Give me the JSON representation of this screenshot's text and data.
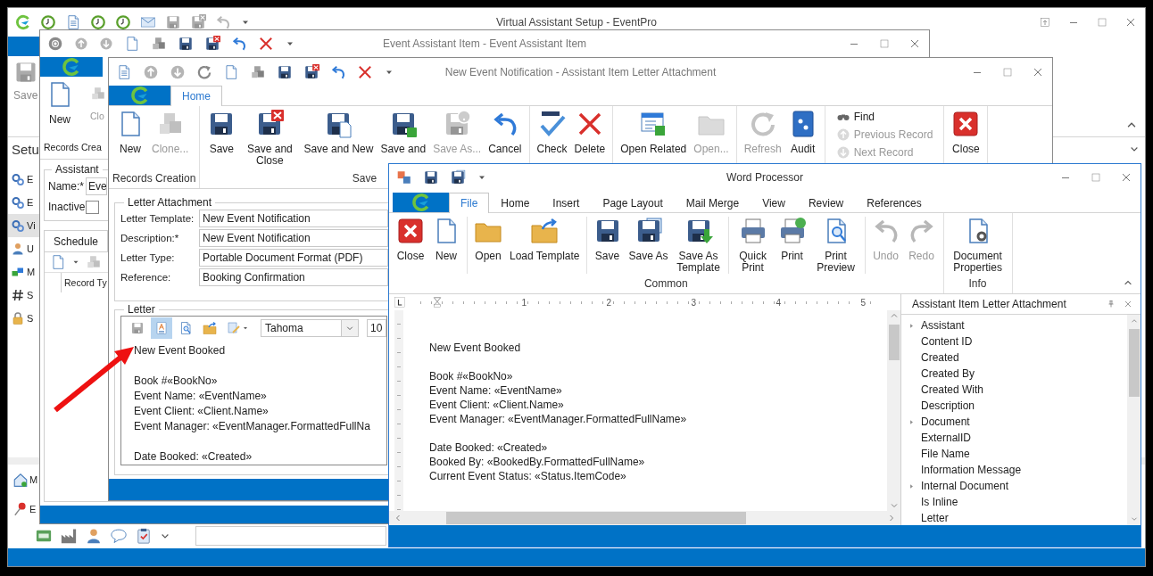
{
  "main_window": {
    "title": "Virtual Assistant Setup - EventPro",
    "ribbon_button": "Save",
    "section_title": "Setu",
    "sidebar_items": [
      {
        "label": "E",
        "selected": false
      },
      {
        "label": "E",
        "selected": false
      },
      {
        "label": "Vi",
        "selected": true
      },
      {
        "label": "U",
        "selected": false
      },
      {
        "label": "M",
        "selected": false
      },
      {
        "label": "S",
        "selected": false
      },
      {
        "label": "S",
        "selected": false
      }
    ],
    "nav_items": [
      "M",
      "E"
    ]
  },
  "assistant_window": {
    "title": "Event Assistant Item - Event Assistant Item",
    "ribbon_buttons": [
      "New",
      "Clo"
    ],
    "ribbon_group": "Records Crea",
    "group_title": "Assistant",
    "name_label": "Name:*",
    "name_value": "Eve",
    "inactive_label": "Inactive",
    "inactive_checked": false,
    "tabs": [
      {
        "label": "Schedule",
        "selected": true
      }
    ],
    "column": "Record Ty"
  },
  "letter_window": {
    "title": "New Event Notification - Assistant Item Letter Attachment",
    "tabs": [
      {
        "label": "Home",
        "selected": true
      }
    ],
    "ribbon_groups": [
      {
        "label": "Records Creation",
        "buttons": [
          {
            "label": "New",
            "disabled": false
          },
          {
            "label": "Clone...",
            "disabled": true
          }
        ]
      },
      {
        "label": "Save",
        "buttons": [
          {
            "label": "Save",
            "disabled": false
          },
          {
            "label": "Save and Close",
            "disabled": false
          },
          {
            "label": "Save and New",
            "disabled": false
          },
          {
            "label": "Save and",
            "disabled": false
          },
          {
            "label": "Save As...",
            "disabled": true
          },
          {
            "label": "Cancel",
            "disabled": false
          }
        ]
      },
      {
        "buttons": [
          {
            "label": "Check",
            "disabled": false
          },
          {
            "label": "Delete",
            "disabled": false
          }
        ]
      },
      {
        "buttons": [
          {
            "label": "Open Related",
            "disabled": false
          },
          {
            "label": "Open...",
            "disabled": true
          }
        ]
      },
      {
        "buttons": [
          {
            "label": "Refresh",
            "disabled": true
          },
          {
            "label": "Audit",
            "disabled": false
          }
        ]
      },
      {
        "small_buttons": [
          {
            "label": "Find",
            "disabled": false
          },
          {
            "label": "Previous Record",
            "disabled": true
          },
          {
            "label": "Next Record",
            "disabled": true
          }
        ]
      },
      {
        "buttons": [
          {
            "label": "Close",
            "disabled": false
          }
        ]
      }
    ],
    "letter_attachment": {
      "title": "Letter Attachment",
      "fields": [
        {
          "label": "Letter Template:",
          "value": "New Event Notification"
        },
        {
          "label": "Description:*",
          "value": "New Event Notification"
        },
        {
          "label": "Letter Type:",
          "value": "Portable Document Format (PDF)"
        },
        {
          "label": "Reference:",
          "value": "Booking Confirmation"
        }
      ]
    },
    "letter": {
      "title": "Letter",
      "toolbar": [
        {
          "selected": false
        },
        {
          "selected": true
        },
        {
          "selected": false
        },
        {
          "selected": false
        },
        {
          "selected": false
        }
      ],
      "font": "Tahoma",
      "font_size": "10",
      "blocks": [
        [
          "New Event Booked"
        ],
        [
          "Book #«BookNo»",
          "Event Name: «EventName»",
          "Event Client: «Client.Name»",
          "Event Manager: «EventManager.FormattedFullNa"
        ],
        [
          "Date Booked: «Created»"
        ]
      ]
    }
  },
  "word_window": {
    "title": "Word Processor",
    "tabs": [
      {
        "label": "File",
        "selected": true
      },
      {
        "label": "Home",
        "selected": false
      },
      {
        "label": "Insert",
        "selected": false
      },
      {
        "label": "Page Layout",
        "selected": false
      },
      {
        "label": "Mail Merge",
        "selected": false
      },
      {
        "label": "View",
        "selected": false
      },
      {
        "label": "Review",
        "selected": false
      },
      {
        "label": "References",
        "selected": false
      }
    ],
    "ribbon_groups": [
      {
        "label": "Common",
        "buttons": [
          {
            "label": "Close",
            "disabled": false
          },
          {
            "label": "New",
            "disabled": false
          },
          {
            "label": "Open",
            "disabled": false
          },
          {
            "label": "Load Template",
            "disabled": false
          },
          {
            "label": "Save",
            "disabled": false
          },
          {
            "label": "Save As",
            "disabled": false
          },
          {
            "label": "Save As Template",
            "disabled": false
          },
          {
            "label": "Quick Print",
            "disabled": false
          },
          {
            "label": "Print",
            "disabled": false
          },
          {
            "label": "Print Preview",
            "disabled": false
          },
          {
            "label": "Undo",
            "disabled": true
          },
          {
            "label": "Redo",
            "disabled": true
          }
        ]
      },
      {
        "label": "Info",
        "buttons": [
          {
            "label": "Document Properties",
            "disabled": false
          }
        ]
      }
    ],
    "ruler_marks": [
      "1",
      "2",
      "3",
      "4",
      "5"
    ],
    "blocks": [
      [
        "New Event Booked"
      ],
      [
        "Book #«BookNo»",
        "Event Name: «EventName»",
        "Event Client: «Client.Name»",
        "Event Manager: «EventManager.FormattedFullName»"
      ],
      [
        "Date Booked: «Created»",
        "Booked By: «BookedBy.FormattedFullName»",
        "Current Event Status: «Status.ItemCode»"
      ]
    ],
    "panel": {
      "title": "Assistant Item Letter Attachment",
      "items": [
        {
          "label": "Assistant",
          "expandable": true
        },
        {
          "label": "Content ID",
          "expandable": false
        },
        {
          "label": "Created",
          "expandable": false
        },
        {
          "label": "Created By",
          "expandable": false
        },
        {
          "label": "Created With",
          "expandable": false
        },
        {
          "label": "Description",
          "expandable": false
        },
        {
          "label": "Document",
          "expandable": true
        },
        {
          "label": "ExternalID",
          "expandable": false
        },
        {
          "label": "File Name",
          "expandable": false
        },
        {
          "label": "Information Message",
          "expandable": false
        },
        {
          "label": "Internal Document",
          "expandable": true
        },
        {
          "label": "Is Inline",
          "expandable": false
        },
        {
          "label": "Letter",
          "expandable": false
        }
      ]
    }
  }
}
